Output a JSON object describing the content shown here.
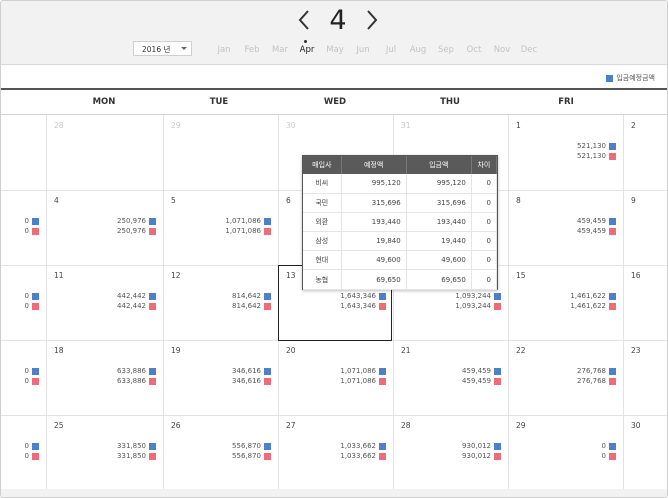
{
  "header": {
    "month_number": "4",
    "year_select": "2016 년",
    "months": [
      "Jan",
      "Feb",
      "Mar",
      "Apr",
      "May",
      "Jun",
      "Jul",
      "Aug",
      "Sep",
      "Oct",
      "Nov",
      "Dec"
    ],
    "active_month": "Apr"
  },
  "legend": {
    "label": "입금예정금액",
    "color": "#4e7fca"
  },
  "weekdays": [
    "MON",
    "TUE",
    "WED",
    "THU",
    "FRI"
  ],
  "colors": {
    "expected": "#4e7fca",
    "deposit": "#ef6b7a"
  },
  "popup": {
    "headers": [
      "매입사",
      "예정액",
      "입금액",
      "차이"
    ],
    "rows": [
      [
        "비씨",
        "995,120",
        "995,120",
        "0"
      ],
      [
        "국민",
        "315,696",
        "315,696",
        "0"
      ],
      [
        "외환",
        "193,440",
        "193,440",
        "0"
      ],
      [
        "삼성",
        "19,840",
        "19,440",
        "0"
      ],
      [
        "현대",
        "49,600",
        "49,600",
        "0"
      ],
      [
        "농협",
        "69,650",
        "69,650",
        "0"
      ]
    ]
  },
  "weeks": [
    {
      "days": [
        {
          "day": "",
          "a": "",
          "b": ""
        },
        {
          "day": "28",
          "a": "",
          "b": "",
          "other": true
        },
        {
          "day": "29",
          "a": "",
          "b": "",
          "other": true
        },
        {
          "day": "30",
          "a": "",
          "b": "",
          "other": true
        },
        {
          "day": "31",
          "a": "",
          "b": "",
          "other": true
        },
        {
          "day": "1",
          "a": "521,130",
          "b": "521,130"
        },
        {
          "day": "2",
          "a": "",
          "b": ""
        }
      ]
    },
    {
      "days": [
        {
          "day": "",
          "a": "0",
          "b": "0"
        },
        {
          "day": "4",
          "a": "250,976",
          "b": "250,976"
        },
        {
          "day": "5",
          "a": "1,071,086",
          "b": "1,071,086"
        },
        {
          "day": "6",
          "a": "",
          "b": ""
        },
        {
          "day": "",
          "a": "",
          "b": ""
        },
        {
          "day": "8",
          "a": "459,459",
          "b": "459,459"
        },
        {
          "day": "9",
          "a": "",
          "b": ""
        }
      ]
    },
    {
      "days": [
        {
          "day": "",
          "a": "0",
          "b": "0"
        },
        {
          "day": "11",
          "a": "442,442",
          "b": "442,442"
        },
        {
          "day": "12",
          "a": "814,642",
          "b": "814,642"
        },
        {
          "day": "13",
          "a": "1,643,346",
          "b": "1,643,346"
        },
        {
          "day": "",
          "a": "1,093,244",
          "b": "1,093,244"
        },
        {
          "day": "15",
          "a": "1,461,622",
          "b": "1,461,622"
        },
        {
          "day": "16",
          "a": "",
          "b": ""
        }
      ]
    },
    {
      "days": [
        {
          "day": "",
          "a": "0",
          "b": "0"
        },
        {
          "day": "18",
          "a": "633,886",
          "b": "633,886"
        },
        {
          "day": "19",
          "a": "346,616",
          "b": "346,616"
        },
        {
          "day": "20",
          "a": "1,071,086",
          "b": "1,071,086"
        },
        {
          "day": "21",
          "a": "459,459",
          "b": "459,459"
        },
        {
          "day": "22",
          "a": "276,768",
          "b": "276,768"
        },
        {
          "day": "23",
          "a": "",
          "b": ""
        }
      ]
    },
    {
      "days": [
        {
          "day": "",
          "a": "0",
          "b": "0"
        },
        {
          "day": "25",
          "a": "331,850",
          "b": "331,850"
        },
        {
          "day": "26",
          "a": "556,870",
          "b": "556,870"
        },
        {
          "day": "27",
          "a": "1,033,662",
          "b": "1,033,662"
        },
        {
          "day": "28",
          "a": "930,012",
          "b": "930,012"
        },
        {
          "day": "29",
          "a": "0",
          "b": "0"
        },
        {
          "day": "30",
          "a": "",
          "b": ""
        }
      ]
    }
  ]
}
